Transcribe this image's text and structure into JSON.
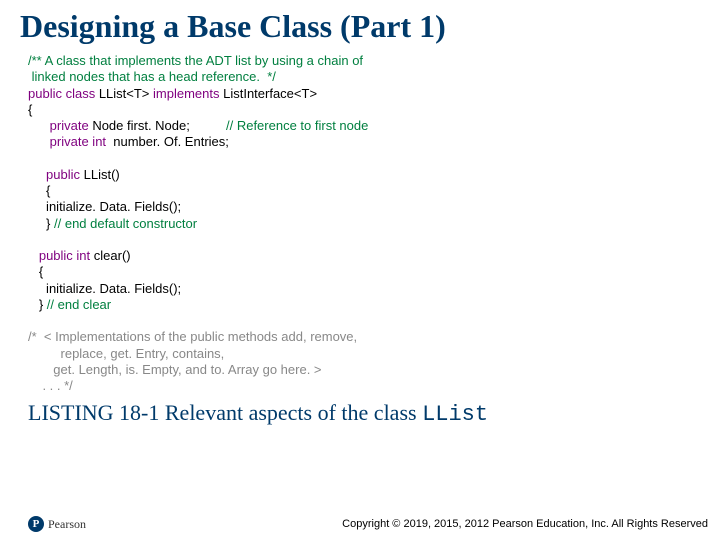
{
  "title": "Designing a Base Class (Part 1)",
  "code": {
    "l1": "/** A class that implements the ADT list by using a chain of",
    "l2": " linked nodes that has a head reference.  */",
    "l3a": "public class",
    "l3b": " LList<T> ",
    "l3c": "implements",
    "l3d": " ListInterface<T>",
    "l4": "{",
    "l5a": "      private",
    "l5b": " Node first. Node;          ",
    "l5c": "// Reference to first node",
    "l6a": "      private int",
    "l6b": "  number. Of. Entries;",
    "l7": " ",
    "l8a": "     public",
    "l8b": " LList()",
    "l9": "     {",
    "l10": "     initialize. Data. Fields();",
    "l11a": "     } ",
    "l11b": "// end default constructor",
    "l12": " ",
    "l13a": "   public int",
    "l13b": " clear()",
    "l14": "   {",
    "l15": "     initialize. Data. Fields();",
    "l16a": "   } ",
    "l16b": "// end clear",
    "l17": " ",
    "l18": "/*  < Implementations of the public methods add, remove,",
    "l19": "         replace, get. Entry, contains,",
    "l20": "       get. Length, is. Empty, and to. Array go here. >",
    "l21": "    . . . */"
  },
  "listing": {
    "prefix": "LISTING 18-1 ",
    "text": "Relevant aspects of the class ",
    "mono": "LList"
  },
  "footer": {
    "logo_letter": "P",
    "logo_text": "Pearson",
    "copyright": "Copyright © 2019, 2015, 2012 Pearson Education, Inc. All Rights Reserved"
  }
}
